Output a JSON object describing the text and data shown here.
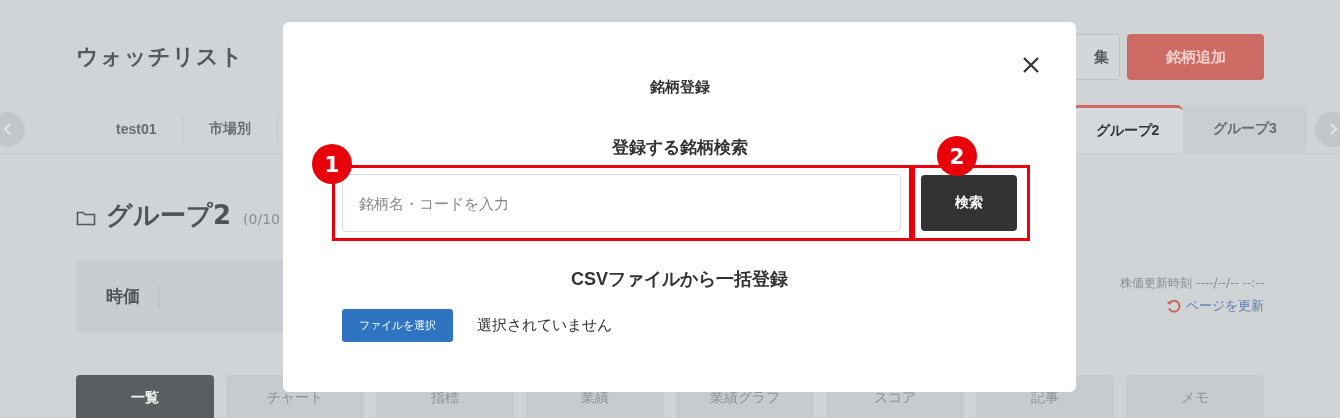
{
  "page": {
    "title": "ウォッチリスト",
    "edit_button": "集",
    "add_button": "銘柄追加"
  },
  "group_tabs": [
    {
      "label": "test01",
      "selected": false
    },
    {
      "label": "市場別",
      "selected": false
    },
    {
      "label": "グループ2",
      "selected": true
    },
    {
      "label": "グループ3",
      "selected": false
    }
  ],
  "group": {
    "name": "グループ2",
    "count": "(0/10"
  },
  "price_panel": {
    "label": "時価",
    "updated": "株価更新時刻 ----/--/-- --:--",
    "refresh_link": "ページを更新"
  },
  "view_tabs": [
    {
      "label": "一覧",
      "selected": true
    },
    {
      "label": "チャート",
      "selected": false
    },
    {
      "label": "指標",
      "selected": false
    },
    {
      "label": "業績",
      "selected": false
    },
    {
      "label": "業績グラフ",
      "selected": false
    },
    {
      "label": "スコア",
      "selected": false
    },
    {
      "label": "記事",
      "selected": false
    },
    {
      "label": "メモ",
      "selected": false
    }
  ],
  "dialog": {
    "title": "銘柄登録",
    "search_heading": "登録する銘柄検索",
    "search_field": {
      "placeholder": "銘柄名・コードを入力"
    },
    "search_button": "検索",
    "csv_heading": "CSVファイルから一括登録",
    "file_button": "ファイルを選択",
    "file_status": "選択されていません"
  },
  "annotations": [
    {
      "label": "1"
    },
    {
      "label": "2"
    }
  ]
}
